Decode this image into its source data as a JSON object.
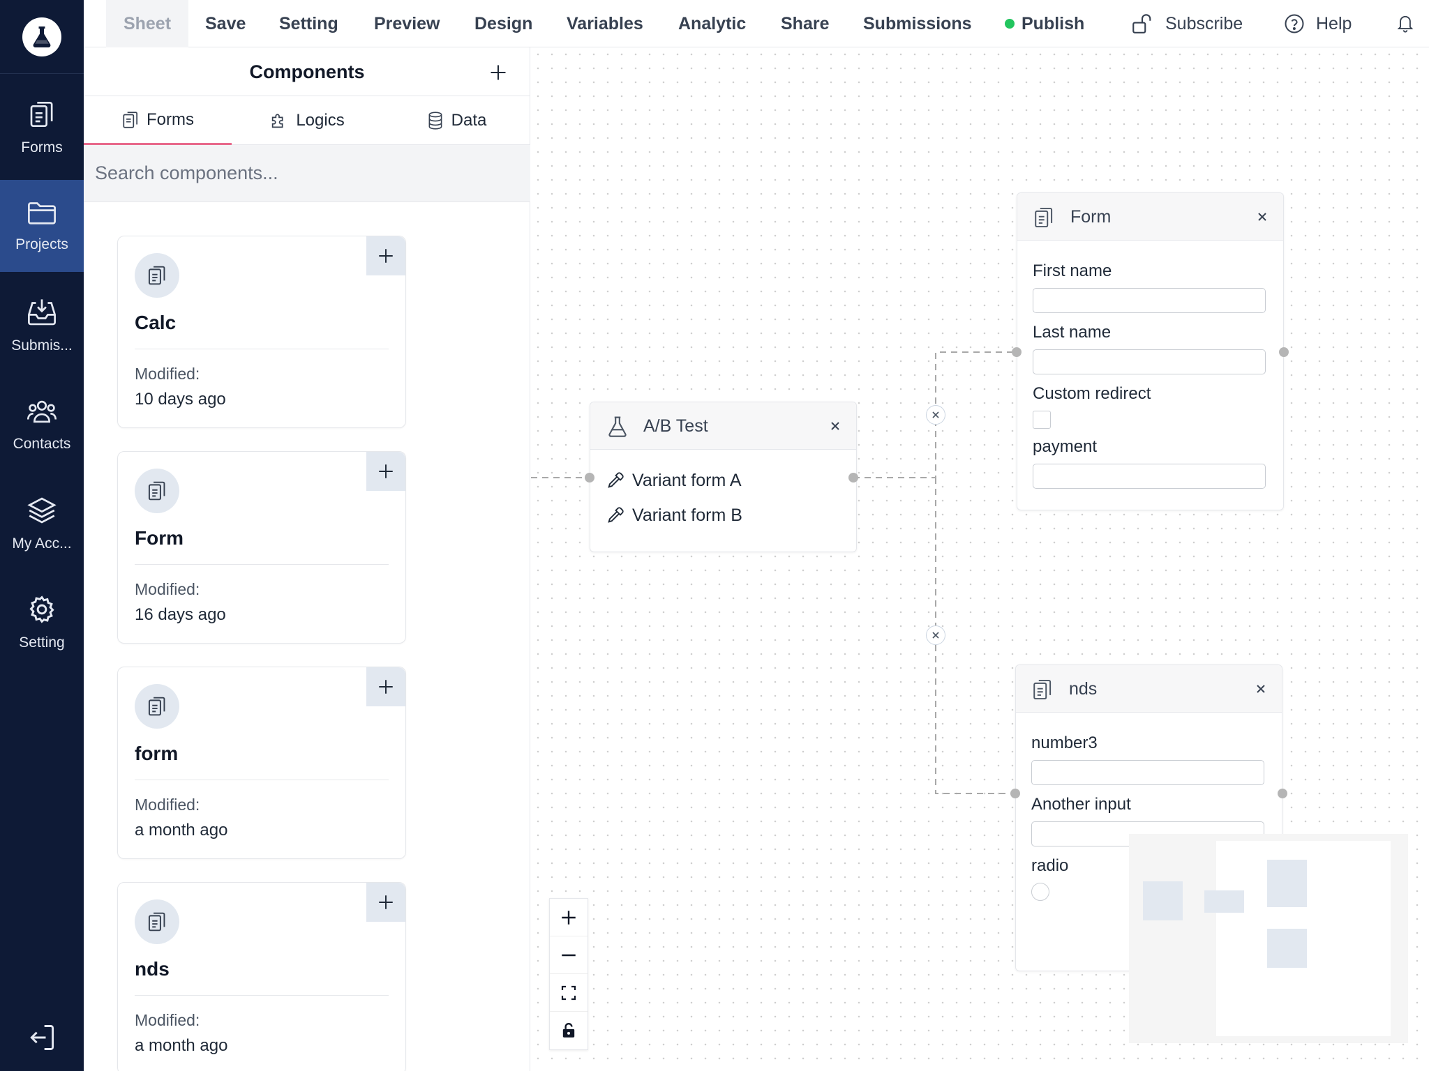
{
  "nav": {
    "items": [
      "Sheet",
      "Save",
      "Setting",
      "Preview",
      "Design",
      "Variables",
      "Analytic",
      "Share",
      "Submissions",
      "Publish"
    ],
    "active": "Sheet",
    "subscribe": "Subscribe",
    "help": "Help"
  },
  "rail": {
    "items": [
      {
        "label": "Forms",
        "icon": "forms-icon"
      },
      {
        "label": "Projects",
        "icon": "folder-icon"
      },
      {
        "label": "Submis...",
        "icon": "inbox-icon"
      },
      {
        "label": "Contacts",
        "icon": "contacts-icon"
      },
      {
        "label": "My Acc...",
        "icon": "layers-icon"
      },
      {
        "label": "Setting",
        "icon": "gear-icon"
      }
    ],
    "active": "Projects"
  },
  "panel": {
    "title": "Components",
    "tabs": [
      "Forms",
      "Logics",
      "Data"
    ],
    "active_tab": "Forms",
    "search_placeholder": "Search components...",
    "modified_label": "Modified:",
    "cards": [
      {
        "name": "Calc",
        "modified": "10 days ago"
      },
      {
        "name": "Form",
        "modified": "16 days ago"
      },
      {
        "name": "form",
        "modified": "a month ago"
      },
      {
        "name": "nds",
        "modified": "a month ago"
      }
    ]
  },
  "canvas": {
    "ab_node": {
      "title": "A/B Test",
      "variants": [
        "Variant form A",
        "Variant form B"
      ]
    },
    "form_node": {
      "title": "Form",
      "fields": [
        "First name",
        "Last name",
        "Custom redirect",
        "payment"
      ]
    },
    "nds_node": {
      "title": "nds",
      "fields": [
        "number3",
        "Another input",
        "radio"
      ]
    }
  },
  "colors": {
    "rail_bg": "#0e1a36",
    "rail_active": "#2b4b8c",
    "tab_underline": "#e86a8c",
    "publish_dot": "#22c55e"
  }
}
